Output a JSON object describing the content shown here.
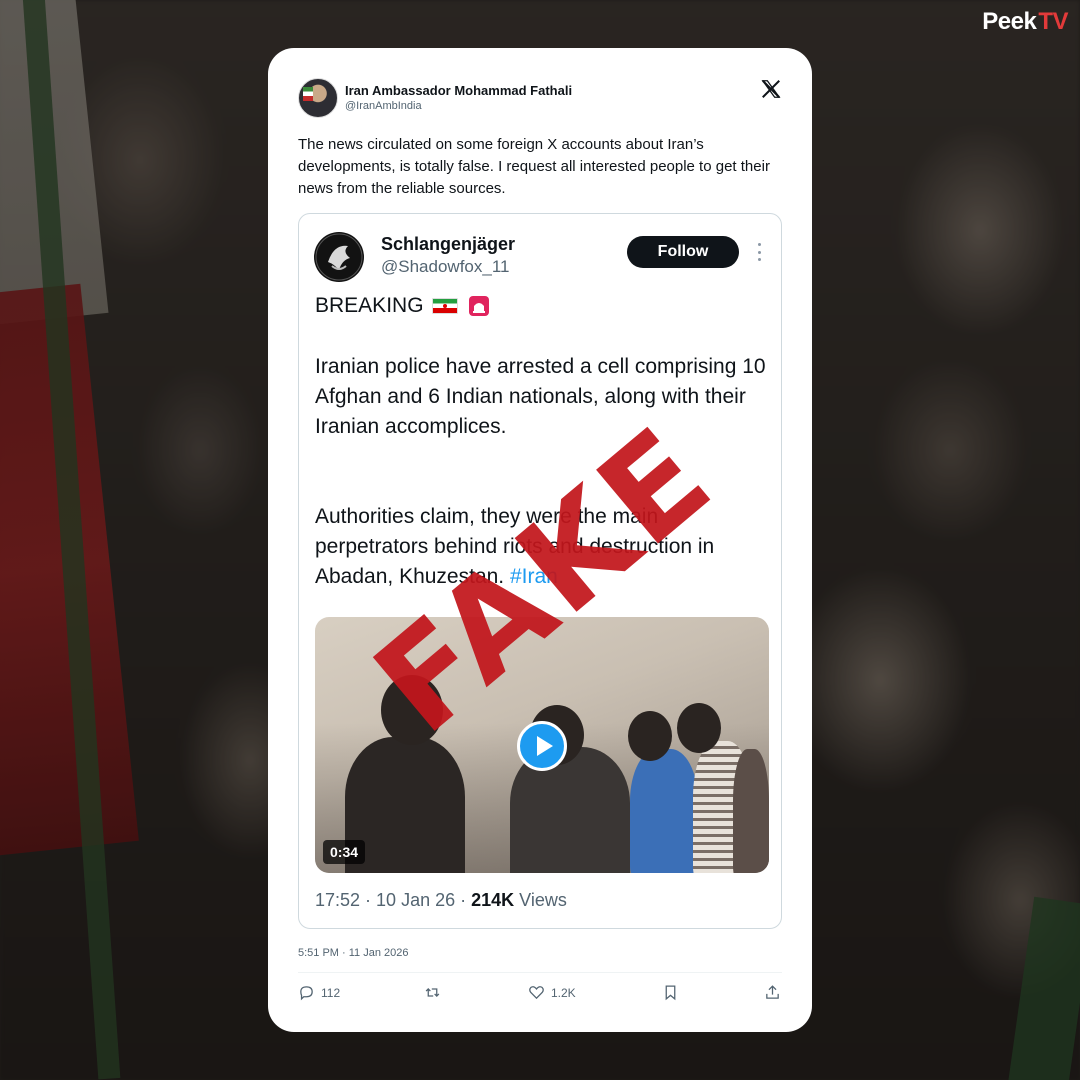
{
  "brand": {
    "name_main": "Peek",
    "name_accent": "TV"
  },
  "tweet": {
    "author_name": "Iran Ambassador Mohammad Fathali",
    "author_handle": "@IranAmbIndia",
    "text": "The news circulated on some foreign X accounts about Iran’s developments, is totally false. I request all interested people to get their news from the reliable sources.",
    "timestamp": "5:51 PM · 11 Jan 2026",
    "actions": {
      "replies": "112",
      "likes": "1.2K"
    }
  },
  "quoted_tweet": {
    "author_name": "Schlangenjäger",
    "author_handle": "@Shadowfox_11",
    "follow_label": "Follow",
    "breaking": "BREAKING",
    "body_1": "Iranian police have arrested a cell comprising 10 Afghan and 6 Indian nationals, along with their Iranian accomplices.",
    "body_2_prefix": "Authorities claim, they were the main perpetrators behind riots and destruction in Abadan, Khuzestan. ",
    "body_2_hashtag": "#Iran",
    "video_duration": "0:34",
    "meta_time": "17:52 · 10 Jan 26 · ",
    "meta_views_count": "214K",
    "meta_views_label": " Views"
  },
  "overlay": {
    "stamp_text": "FAKE"
  },
  "colors": {
    "stamp": "#c2161c",
    "link": "#1d9bf0",
    "brand_accent": "#e23a3a"
  },
  "icons": [
    "x-logo-icon",
    "reply-icon",
    "retweet-icon",
    "like-icon",
    "bookmark-icon",
    "share-icon",
    "play-icon",
    "more-icon"
  ]
}
